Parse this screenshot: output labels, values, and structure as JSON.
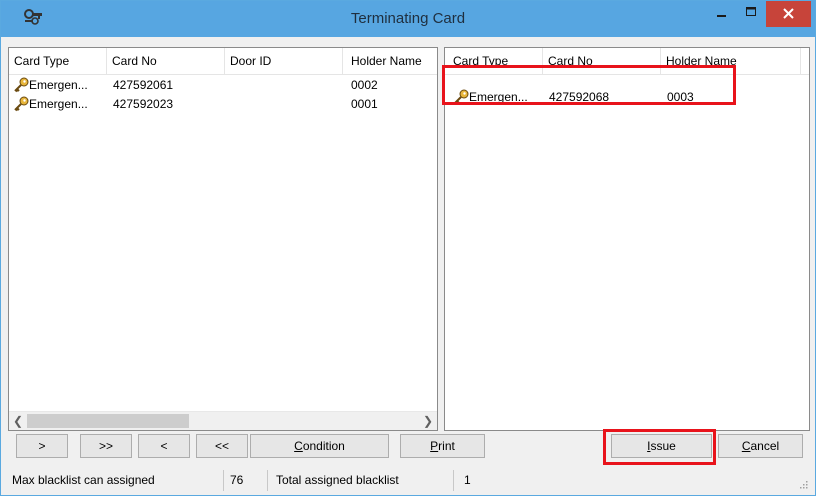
{
  "window": {
    "title": "Terminating Card",
    "accent": "#57a6e1",
    "close_color": "#c7443a",
    "highlight_color": "#e8131b"
  },
  "left_list": {
    "columns": [
      "Card Type",
      "Card No",
      "Door ID",
      "Holder Name"
    ],
    "rows": [
      {
        "icon": "key-icon",
        "card_type": "Emergen...",
        "card_no": "427592061",
        "door_id": "",
        "holder": "0002"
      },
      {
        "icon": "key-icon",
        "card_type": "Emergen...",
        "card_no": "427592023",
        "door_id": "",
        "holder": "0001"
      }
    ]
  },
  "right_list": {
    "columns": [
      "Card Type",
      "Card No",
      "Holder Name"
    ],
    "rows": [
      {
        "icon": "key-icon",
        "card_type": "Emergen...",
        "card_no": "427592068",
        "holder": "0003"
      }
    ]
  },
  "buttons": {
    "move_right": ">",
    "move_all_right": ">>",
    "move_left": "<",
    "move_all_left": "<<",
    "condition_prefix": "",
    "condition_mnemonic": "C",
    "condition_rest": "ondition",
    "print_mnemonic": "P",
    "print_rest": "rint",
    "issue_mnemonic": "I",
    "issue_rest": "ssue",
    "cancel_mnemonic": "C",
    "cancel_rest": "ancel"
  },
  "status": {
    "max_label": "Max blacklist can assigned",
    "max_value": "76",
    "total_label": "Total assigned blacklist",
    "total_value": "1"
  }
}
